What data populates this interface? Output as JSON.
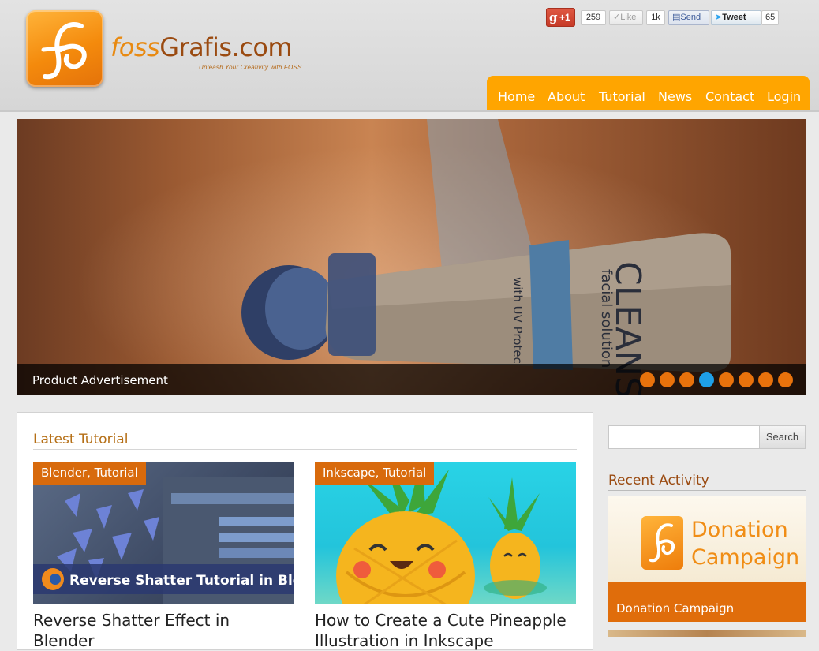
{
  "logo": {
    "part1": "foss",
    "part2": "Grafis.com",
    "tagline": "Unleash Your Creativity with FOSS"
  },
  "social": {
    "gplus_label": "+1",
    "gplus_count": "259",
    "like_label": "Like",
    "like_count": "1k",
    "send_label": "Send",
    "tweet_label": "Tweet",
    "tweet_count": "65"
  },
  "nav": {
    "items": [
      "Home",
      "About",
      "Tutorial",
      "News",
      "Contact",
      "Login"
    ]
  },
  "slider": {
    "caption": "Product Advertisement",
    "dot_count": 8,
    "active_dot": 4,
    "product_text": "CLEANS",
    "product_sub": "facial solution",
    "product_band": "with UV Protec"
  },
  "latest": {
    "title": "Latest Tutorial",
    "cards": [
      {
        "tag": "Blender, Tutorial",
        "banner": "Reverse Shatter Tutorial in Blender",
        "title": "Reverse Shatter Effect in Blender"
      },
      {
        "tag": "Inkscape, Tutorial",
        "title": "How to Create a Cute Pineapple Illustration in Inkscape"
      }
    ]
  },
  "sidebar": {
    "search_button": "Search",
    "search_placeholder": "",
    "recent_title": "Recent Activity",
    "donation_image_text_1": "Donation",
    "donation_image_text_2": "Campaign",
    "donation_label": "Donation Campaign"
  },
  "colors": {
    "accent": "#ffa500",
    "tag": "#d86a0c",
    "active_dot": "#1ea0e8"
  }
}
